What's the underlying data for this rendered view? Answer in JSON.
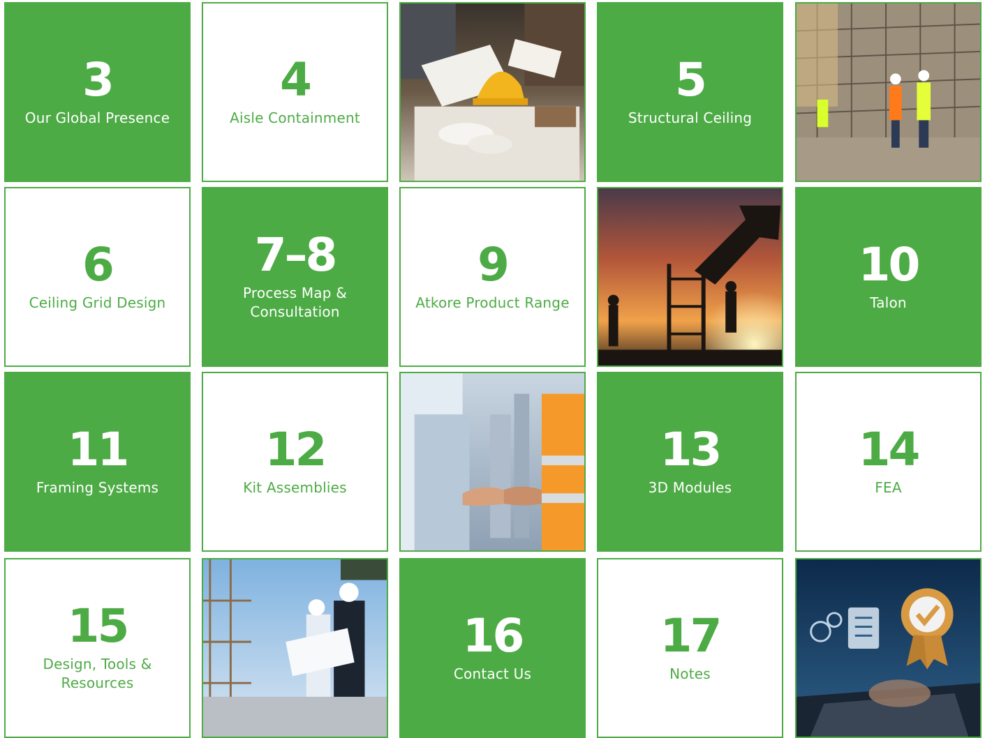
{
  "colors": {
    "brand_green": "#4dab45",
    "white": "#ffffff"
  },
  "tiles": [
    {
      "number": "3",
      "label": "Our Global Presence"
    },
    {
      "number": "4",
      "label": "Aisle Containment"
    },
    {
      "number": "5",
      "label": "Structural Ceiling"
    },
    {
      "number": "6",
      "label": "Ceiling Grid Design"
    },
    {
      "number": "7–8",
      "label": "Process Map & Consultation"
    },
    {
      "number": "9",
      "label": "Atkore Product Range"
    },
    {
      "number": "10",
      "label": "Talon"
    },
    {
      "number": "11",
      "label": "Framing Systems"
    },
    {
      "number": "12",
      "label": "Kit Assemblies"
    },
    {
      "number": "13",
      "label": "3D Modules"
    },
    {
      "number": "14",
      "label": "FEA"
    },
    {
      "number": "15",
      "label": "Design, Tools & Resources"
    },
    {
      "number": "16",
      "label": "Contact Us"
    },
    {
      "number": "17",
      "label": "Notes"
    }
  ],
  "photos": [
    {
      "icon": "blueprints-hardhat-photo"
    },
    {
      "icon": "construction-site-workers-photo"
    },
    {
      "icon": "sunset-excavator-photo"
    },
    {
      "icon": "handshake-photo"
    },
    {
      "icon": "engineers-blueprint-photo"
    },
    {
      "icon": "certification-laptop-photo"
    }
  ]
}
